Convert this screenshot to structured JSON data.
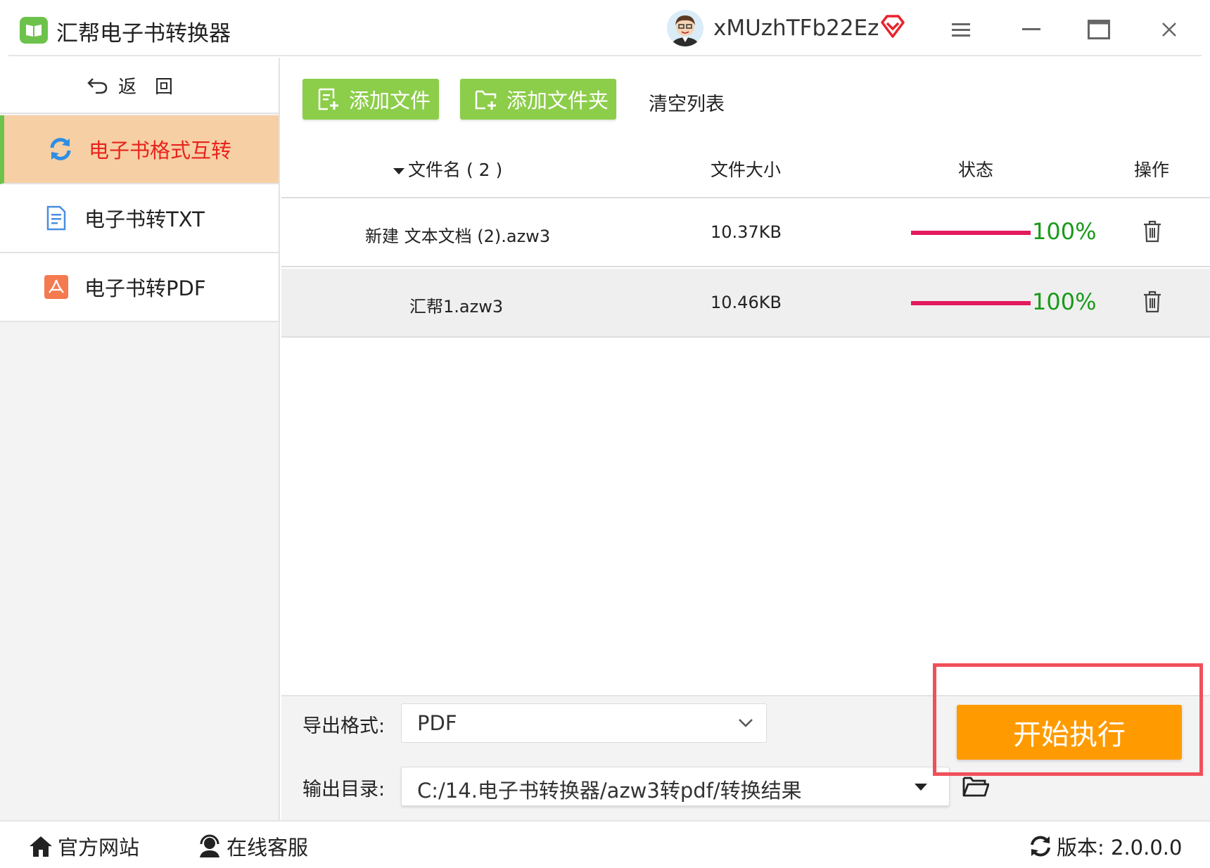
{
  "app": {
    "title": "汇帮电子书转换器",
    "username": "xMUzhTFb22Ez",
    "brand_green": "#6cc24a",
    "accent_orange": "#ff9b00"
  },
  "window_controls": {
    "menu_icon": "menu-icon",
    "minimize_icon": "minimize-icon",
    "maximize_icon": "maximize-icon",
    "close_icon": "close-icon"
  },
  "sidebar": {
    "back_label": "返回",
    "items": [
      {
        "label": "电子书格式互转",
        "icon": "convert-icon",
        "active": true
      },
      {
        "label": "电子书转TXT",
        "icon": "document-icon",
        "active": false
      },
      {
        "label": "电子书转PDF",
        "icon": "pdf-icon",
        "active": false
      }
    ]
  },
  "toolbar": {
    "add_file": "添加文件",
    "add_folder": "添加文件夹",
    "clear_list": "清空列表"
  },
  "table": {
    "headers": {
      "filename": "文件名 ( 2 )",
      "size": "文件大小",
      "status": "状态",
      "action": "操作"
    },
    "rows": [
      {
        "filename": "新建 文本文档 (2).azw3",
        "size": "10.37KB",
        "progress": 1.0,
        "progress_text": "100%"
      },
      {
        "filename": "汇帮1.azw3",
        "size": "10.46KB",
        "progress": 1.0,
        "progress_text": "100%"
      }
    ]
  },
  "settings": {
    "format_label": "导出格式:",
    "format_value": "PDF",
    "output_label": "输出目录:",
    "output_value": "C:/14.电子书转换器/azw3转pdf/转换结果",
    "run_button": "开始执行"
  },
  "footer": {
    "website": "官方网站",
    "support": "在线客服",
    "version": "版本:  2.0.0.0"
  }
}
